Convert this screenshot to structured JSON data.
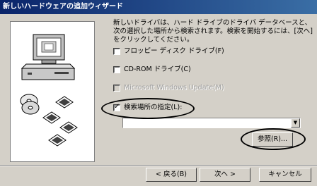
{
  "window": {
    "title": "新しいハードウェアの追加ウィザード"
  },
  "instructions": "新しいドライバは、ハード ドライブのドライバ データベースと、次の選択した場所から検索されます。検索を開始するには、[次へ] をクリックしてください。",
  "options": [
    {
      "label": "フロッピー ディスク ドライブ(F)",
      "checked": false,
      "enabled": true
    },
    {
      "label": "CD-ROM ドライブ(C)",
      "checked": false,
      "enabled": true
    },
    {
      "label": "Microsoft Windows Update(M)",
      "checked": false,
      "enabled": false
    },
    {
      "label": "検索場所の指定(L):",
      "checked": true,
      "enabled": true
    }
  ],
  "location": {
    "value": ""
  },
  "buttons": {
    "browse": "参照(R)...",
    "back": "< 戻る(B)",
    "next": "次へ >",
    "cancel": "キャンセル"
  },
  "icons": {
    "check": "✓",
    "dropdown": "▼"
  }
}
